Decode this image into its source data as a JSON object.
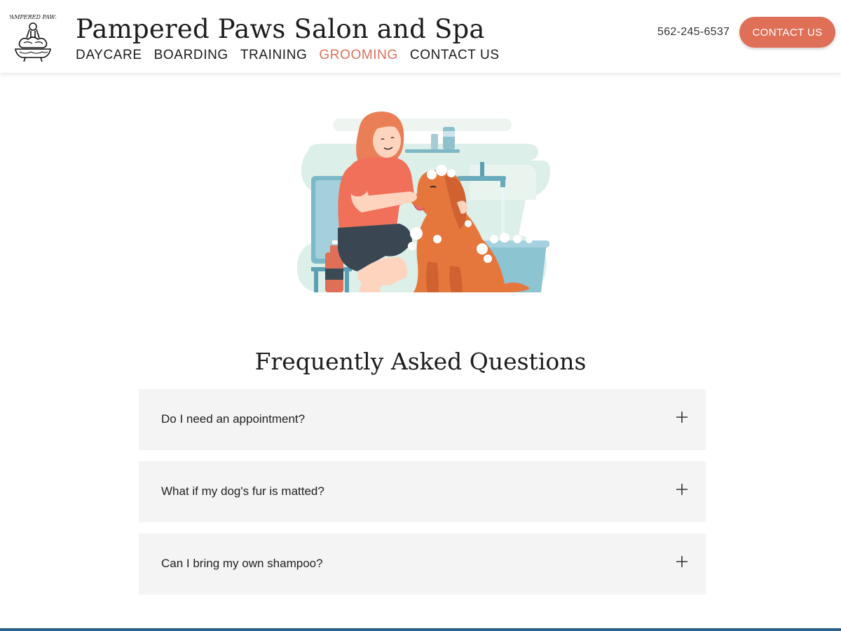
{
  "header": {
    "logo_icon": "pampered-paws-logo",
    "logo_text": "PAMPERED PAWS",
    "title": "Pampered Paws Salon and Spa",
    "phone": "562-245-6537",
    "cta_label": "CONTACT US"
  },
  "nav": {
    "items": [
      {
        "label": "DAYCARE",
        "active": false
      },
      {
        "label": "BOARDING",
        "active": false
      },
      {
        "label": "TRAINING",
        "active": false
      },
      {
        "label": "GROOMING",
        "active": true
      },
      {
        "label": "CONTACT US",
        "active": false
      }
    ]
  },
  "hero": {
    "illustration_icon": "dog-grooming-illustration"
  },
  "faq": {
    "title": "Frequently Asked Questions",
    "items": [
      {
        "question": "Do I need an appointment?",
        "toggle_icon": "plus-icon"
      },
      {
        "question": "What if my dog's fur is matted?",
        "toggle_icon": "plus-icon"
      },
      {
        "question": "Can I bring my own shampoo?",
        "toggle_icon": "plus-icon"
      }
    ]
  },
  "colors": {
    "accent": "#e06f57",
    "nav_active": "#e0705a",
    "faq_bg": "#f4f4f4",
    "footer_bar": "#2b5f8f"
  }
}
